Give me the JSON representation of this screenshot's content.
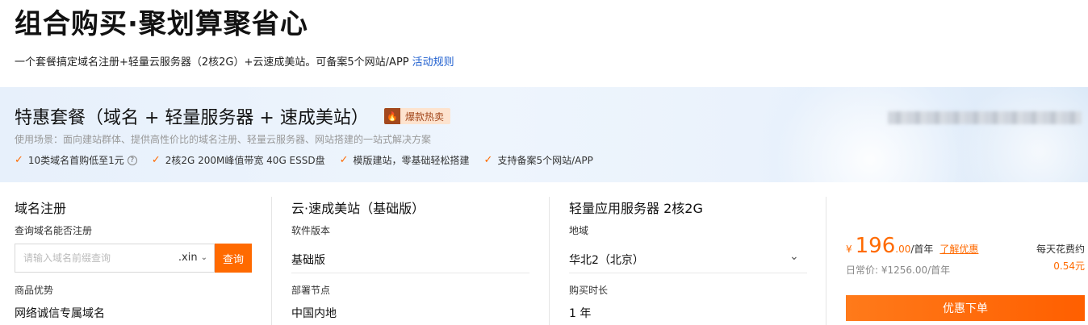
{
  "header": {
    "title": "组合购买·聚划算聚省心",
    "subtitle": "一个套餐搞定域名注册+轻量云服务器（2核2G）+云速成美站。可备案5个网站/APP",
    "rules_link": "活动规则"
  },
  "banner": {
    "title": "特惠套餐（域名 + 轻量服务器 + 速成美站）",
    "badge": "爆款热卖",
    "badge_icon": "fire-icon",
    "description": "使用场景：面向建站群体、提供高性价比的域名注册、轻量云服务器、网站搭建的一站式解决方案",
    "features": [
      "10类域名首购低至1元",
      "2核2G 200M峰值带宽 40G ESSD盘",
      "模版建站，零基础轻松搭建",
      "支持备案5个网站/APP"
    ],
    "feature_help": "?"
  },
  "domain": {
    "title": "域名注册",
    "query_label": "查询域名能否注册",
    "input_placeholder": "请输入域名前缀查询",
    "suffix": ".xin",
    "search_button": "查询",
    "advantage_label": "商品优势",
    "advantage_value": "网络诚信专属域名"
  },
  "site": {
    "title": "云·速成美站（基础版）",
    "version_label": "软件版本",
    "version_value": "基础版",
    "node_label": "部署节点",
    "node_value": "中国内地"
  },
  "server": {
    "title": "轻量应用服务器 2核2G",
    "region_label": "地域",
    "region_value": "华北2（北京）",
    "duration_label": "购买时长",
    "duration_value": "1 年"
  },
  "price": {
    "currency": "¥",
    "amount": "196",
    "decimal": ".00",
    "unit": "/首年",
    "learn_more": "了解优惠",
    "original": "日常价: ¥1256.00/首年",
    "daily_label": "每天花费约",
    "daily_value": "0.54元",
    "buy_button": "优惠下单"
  },
  "colors": {
    "accent": "#ff6a00",
    "link": "#1f5fcf"
  }
}
